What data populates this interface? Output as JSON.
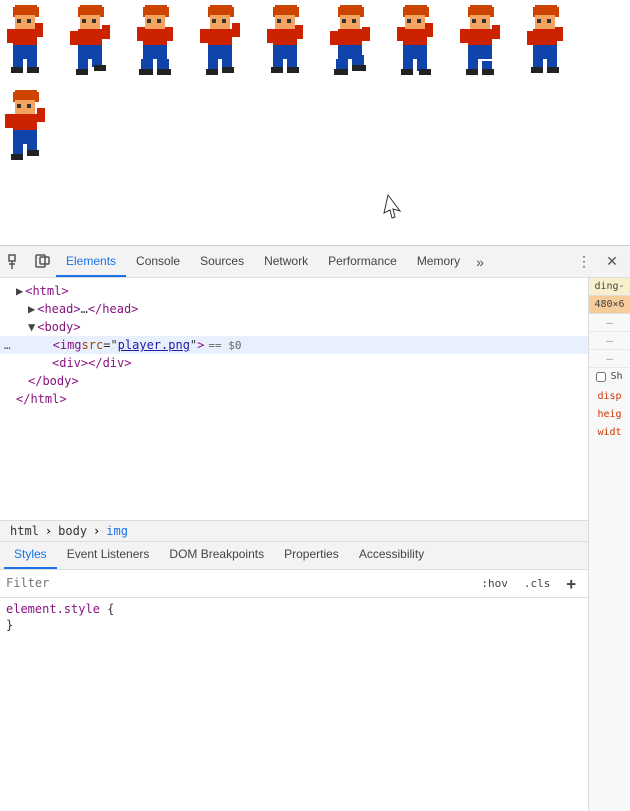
{
  "sprite_area": {
    "description": "Pixel art sprite sheet - walking character frames"
  },
  "devtools": {
    "toolbar": {
      "inspect_icon": "⊡",
      "device_icon": "⬜",
      "tabs": [
        "Elements",
        "Console",
        "Sources",
        "Network",
        "Performance",
        "Memory"
      ],
      "active_tab": "Elements",
      "more_icon": "»",
      "settings_icon": "⋮",
      "close_icon": "✕"
    },
    "html_tree": {
      "lines": [
        {
          "indent": 0,
          "content": "<html>",
          "type": "open-tag"
        },
        {
          "indent": 1,
          "content": "<head>…</head>",
          "type": "collapsed"
        },
        {
          "indent": 1,
          "content": "<body>",
          "type": "open-tag"
        },
        {
          "indent": 2,
          "content": "<img src=\"player.png\"> == $0",
          "type": "selected",
          "has_dots": true
        },
        {
          "indent": 3,
          "content": "<div></div>",
          "type": "tag"
        },
        {
          "indent": 2,
          "content": "</body>",
          "type": "close-tag"
        },
        {
          "indent": 0,
          "content": "</html>",
          "type": "close-tag"
        }
      ]
    },
    "breadcrumb": [
      "html",
      "body",
      "img"
    ],
    "bottom_tabs": [
      "Styles",
      "Event Listeners",
      "DOM Breakpoints",
      "Properties",
      "Accessibility"
    ],
    "active_bottom_tab": "Styles",
    "styles": {
      "filter_placeholder": "Filter",
      "hov_label": ":hov",
      "cls_label": ".cls",
      "add_icon": "+",
      "rule": {
        "selector": "element.style",
        "open": "{",
        "close": "}"
      }
    },
    "box_model": {
      "labels": [
        "ding-",
        "480 × 6",
        "–",
        "–",
        "–"
      ],
      "show_label": "Sh",
      "computed": [
        "disp",
        "heig",
        "widt"
      ]
    }
  }
}
